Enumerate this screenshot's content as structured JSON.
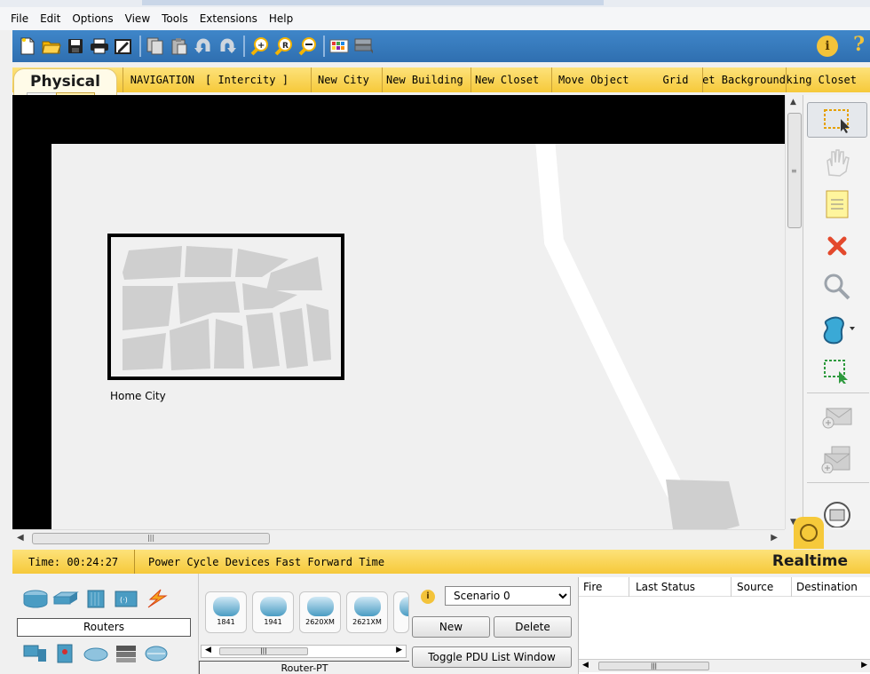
{
  "menu": [
    "File",
    "Edit",
    "Options",
    "View",
    "Tools",
    "Extensions",
    "Help"
  ],
  "toolbar": {
    "icons": [
      "new-icon",
      "open-icon",
      "save-icon",
      "print-icon",
      "activity-wizard-icon",
      "copy-icon",
      "paste-icon",
      "undo-icon",
      "redo-icon",
      "zoom-in-icon",
      "zoom-reset-icon",
      "zoom-out-icon",
      "palette-icon",
      "custom-device-icon"
    ],
    "info_label": "i",
    "help_label": "?"
  },
  "physical_tab": "Physical",
  "nav": {
    "navigation": "NAVIGATION",
    "location": "[ Intercity ]",
    "new_city": "New City",
    "new_building": "New Building",
    "new_closet": "New Closet",
    "move_object": "Move Object",
    "grid": "Grid",
    "set_background": "Set Background",
    "working_closet": "Working Closet"
  },
  "workspace": {
    "city_label": "Home City"
  },
  "status": {
    "time": "Time: 00:24:27",
    "power_cycle": "Power Cycle Devices",
    "fast_forward": "Fast Forward Time",
    "mode": "Realtime"
  },
  "devices": {
    "category": "Routers",
    "models": [
      "1841",
      "1941",
      "2620XM",
      "2621XM"
    ],
    "selected_name": "Router-PT"
  },
  "scenario": {
    "selected": "Scenario 0",
    "new": "New",
    "delete": "Delete",
    "toggle": "Toggle PDU List Window"
  },
  "pdu_table": {
    "columns": [
      "Fire",
      "Last Status",
      "Source",
      "Destination"
    ]
  },
  "colors": {
    "toolbar_blue": "#2f6fb0",
    "nav_yellow": "#f6c93a"
  }
}
